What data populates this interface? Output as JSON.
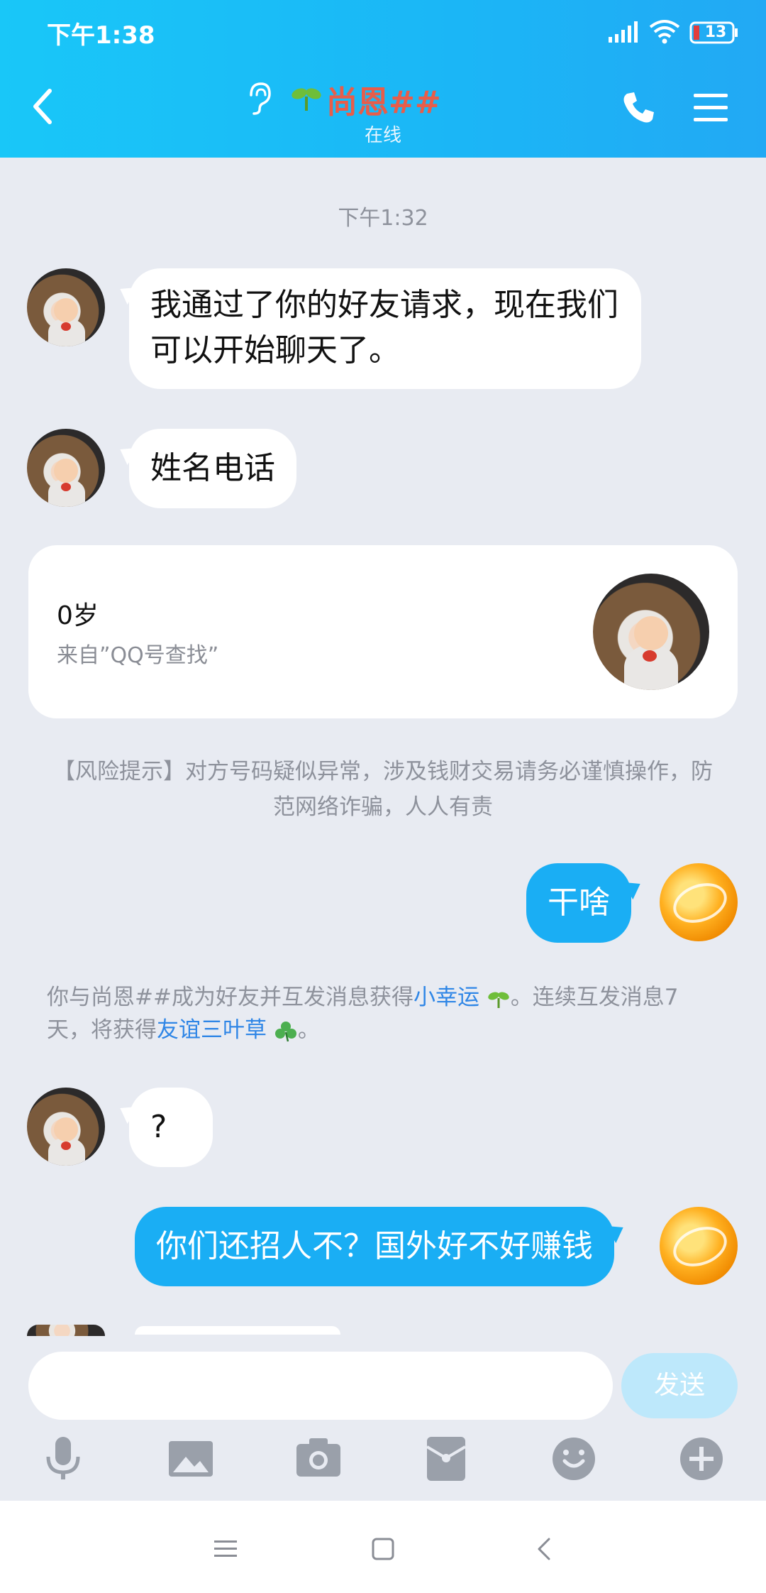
{
  "status_bar": {
    "time": "下午1:38",
    "battery": "13"
  },
  "header": {
    "contact_name": "尚恩##",
    "contact_status": "在线"
  },
  "chat": {
    "timestamp": "下午1:32",
    "msg1": "我通过了你的好友请求，现在我们可以开始聊天了。",
    "msg2": "姓名电话",
    "card": {
      "age": "0岁",
      "source": "来自”QQ号查找”"
    },
    "risk_notice": "【风险提示】对方号码疑似异常，涉及钱财交易请务必谨慎操作，防范网络诈骗，人人有责",
    "my_msg1": "干啥",
    "system_note": {
      "part1": "你与尚恩##成为好友并互发消息获得",
      "link1": "小幸运",
      "part2": "。连续互发消息7天，将获得",
      "link2": "友谊三叶草",
      "part3": "。"
    },
    "msg3": "?",
    "my_msg2": "你们还招人不？国外好不好赚钱"
  },
  "input": {
    "placeholder": "",
    "send_label": "发送"
  },
  "colors": {
    "header": "#1bb6f6",
    "my_bubble": "#1aaef4",
    "name": "#e85d4a",
    "link": "#2f86e6"
  }
}
